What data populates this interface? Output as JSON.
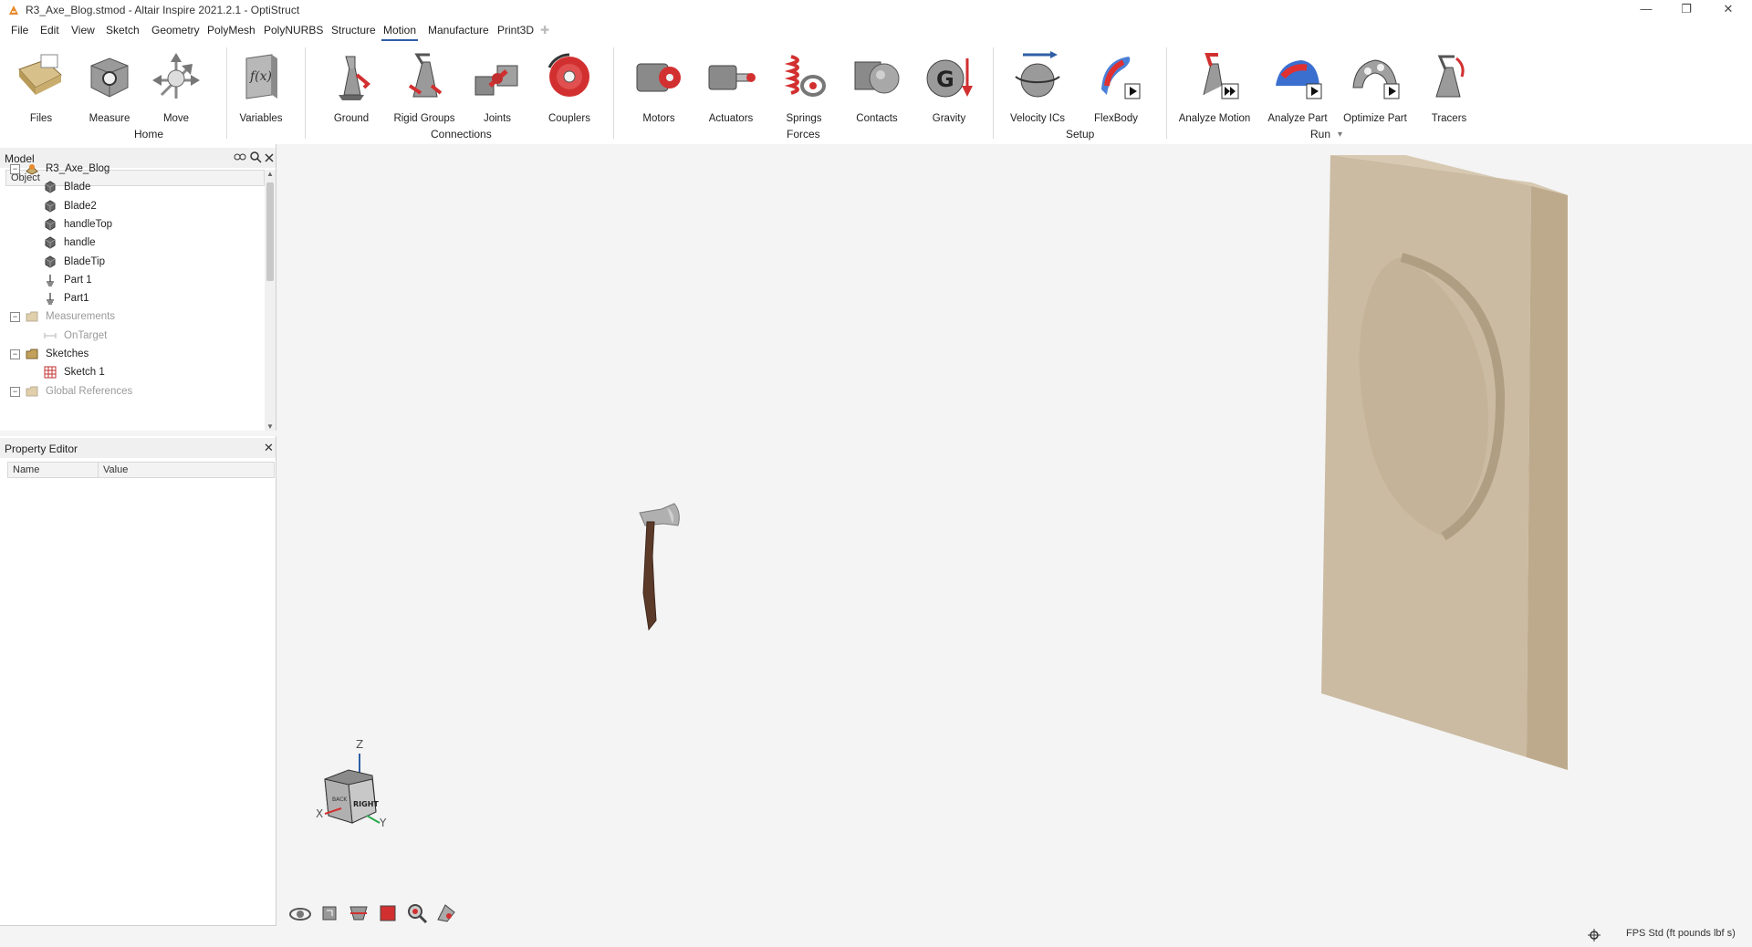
{
  "window": {
    "title": "R3_Axe_Blog.stmod - Altair Inspire 2021.2.1 - OptiStruct",
    "minimize_glyph": "—",
    "restore_glyph": "❐",
    "close_glyph": "✕"
  },
  "menu": {
    "items": [
      "File",
      "Edit",
      "View",
      "Sketch",
      "Geometry",
      "PolyMesh",
      "PolyNURBS",
      "Structure",
      "Motion",
      "Manufacture",
      "Print3D"
    ],
    "active": "Motion",
    "add_tab_glyph": "✚"
  },
  "ribbon": {
    "tools": [
      {
        "label": "Files",
        "icon": "files-icon"
      },
      {
        "label": "Measure",
        "icon": "measure-icon"
      },
      {
        "label": "Move",
        "icon": "move-icon"
      },
      {
        "label": "Variables",
        "icon": "variables-icon"
      },
      {
        "label": "Ground",
        "icon": "ground-icon"
      },
      {
        "label": "Rigid Groups",
        "icon": "rigid-groups-icon"
      },
      {
        "label": "Joints",
        "icon": "joints-icon"
      },
      {
        "label": "Couplers",
        "icon": "couplers-icon"
      },
      {
        "label": "Motors",
        "icon": "motors-icon"
      },
      {
        "label": "Actuators",
        "icon": "actuators-icon"
      },
      {
        "label": "Springs",
        "icon": "springs-icon"
      },
      {
        "label": "Contacts",
        "icon": "contacts-icon"
      },
      {
        "label": "Gravity",
        "icon": "gravity-icon"
      },
      {
        "label": "Velocity ICs",
        "icon": "velocity-ics-icon"
      },
      {
        "label": "FlexBody",
        "icon": "flexbody-icon"
      },
      {
        "label": "Analyze Motion",
        "icon": "analyze-motion-icon"
      },
      {
        "label": "Analyze Part",
        "icon": "analyze-part-icon"
      },
      {
        "label": "Optimize Part",
        "icon": "optimize-part-icon"
      },
      {
        "label": "Tracers",
        "icon": "tracers-icon"
      }
    ],
    "groups": [
      "Home",
      "Connections",
      "Forces",
      "Setup",
      "Run"
    ],
    "variables_glyph": "f(x)",
    "gravity_glyph": "G",
    "run_dropdown_glyph": "▾"
  },
  "model_panel": {
    "title": "Model",
    "column": "Object",
    "tree": [
      {
        "label": "R3_Axe_Blog",
        "level": 0,
        "icon": "assembly-icon",
        "expander": "−",
        "dim": false
      },
      {
        "label": "Blade",
        "level": 1,
        "icon": "part-icon",
        "dim": false
      },
      {
        "label": "Blade2",
        "level": 1,
        "icon": "part-icon",
        "dim": false
      },
      {
        "label": "handleTop",
        "level": 1,
        "icon": "part-icon",
        "dim": false
      },
      {
        "label": "handle",
        "level": 1,
        "icon": "part-icon",
        "dim": false
      },
      {
        "label": "BladeTip",
        "level": 1,
        "icon": "part-icon",
        "dim": false
      },
      {
        "label": "Part 1",
        "level": 1,
        "icon": "ground-part-icon",
        "dim": false
      },
      {
        "label": "Part1",
        "level": 1,
        "icon": "ground-part-icon",
        "dim": false
      },
      {
        "label": "Measurements",
        "level": 0,
        "icon": "folder-icon",
        "expander": "−",
        "dim": true
      },
      {
        "label": "OnTarget",
        "level": 1,
        "icon": "measure-icon",
        "dim": true
      },
      {
        "label": "Sketches",
        "level": 0,
        "icon": "folder-icon",
        "expander": "−",
        "dim": false
      },
      {
        "label": "Sketch 1",
        "level": 1,
        "icon": "sketch-icon",
        "dim": false
      },
      {
        "label": "Global References",
        "level": 0,
        "icon": "folder-icon",
        "expander": "−",
        "dim": true
      }
    ]
  },
  "property_editor": {
    "title": "Property Editor",
    "columns": [
      "Name",
      "Value"
    ],
    "close_glyph": "✕"
  },
  "viewcube": {
    "face_label": "RIGHT",
    "side_label": "BACK",
    "axis_x": "X",
    "axis_y": "Y",
    "axis_z": "Z"
  },
  "status": {
    "units": "FPS Std (ft pounds lbf s)"
  },
  "colors": {
    "accent": "#2f5ea6",
    "target_board": "#cbbba2",
    "axe_handle": "#5b3a2a",
    "axe_head": "#a9a9a9"
  }
}
